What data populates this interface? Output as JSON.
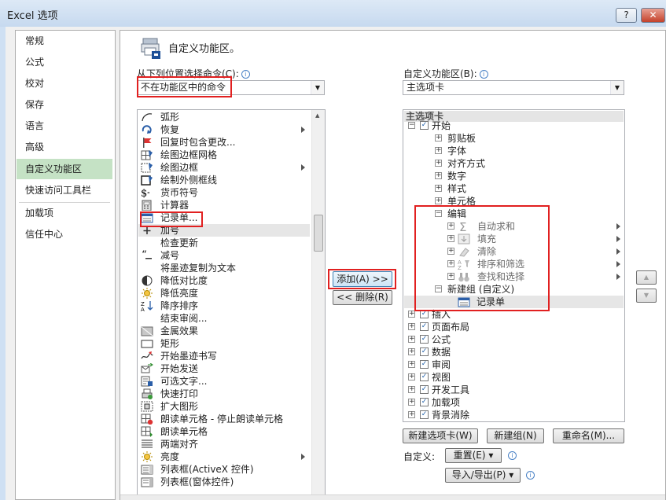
{
  "window": {
    "title": "Excel 选项",
    "help_label": "?",
    "close_label": "✕"
  },
  "nav": {
    "items": [
      {
        "label": "常规"
      },
      {
        "label": "公式"
      },
      {
        "label": "校对"
      },
      {
        "label": "保存"
      },
      {
        "label": "语言"
      },
      {
        "label": "高级"
      },
      {
        "label": "自定义功能区"
      },
      {
        "label": "快速访问工具栏"
      },
      {
        "label": "加载项"
      },
      {
        "label": "信任中心"
      }
    ],
    "selected": "自定义功能区"
  },
  "header": {
    "title": "自定义功能区。"
  },
  "left": {
    "label": "从下列位置选择命令(C):",
    "combo_value": "不在功能区中的命令",
    "commands": [
      {
        "label": "弧形",
        "icon": "arc-icon"
      },
      {
        "label": "恢复",
        "icon": "redo-icon",
        "submenu": true
      },
      {
        "label": "回复时包含更改...",
        "icon": "flag-icon"
      },
      {
        "label": "绘图边框网格",
        "icon": "border-grid-icon"
      },
      {
        "label": "绘图边框",
        "icon": "draw-border-icon",
        "submenu": true
      },
      {
        "label": "绘制外侧框线",
        "icon": "outside-border-icon"
      },
      {
        "label": "货币符号",
        "icon": "currency-icon"
      },
      {
        "label": "计算器",
        "icon": "calculator-icon"
      },
      {
        "label": "记录单...",
        "icon": "form-icon"
      },
      {
        "label": "加号",
        "icon": "plus-icon"
      },
      {
        "label": "检查更新",
        "icon": "none"
      },
      {
        "label": "减号",
        "icon": "minus-quote-icon"
      },
      {
        "label": "将墨迹复制为文本",
        "icon": "none"
      },
      {
        "label": "降低对比度",
        "icon": "contrast-icon"
      },
      {
        "label": "降低亮度",
        "icon": "brightness-icon"
      },
      {
        "label": "降序排序",
        "icon": "sort-desc-icon"
      },
      {
        "label": "结束审阅...",
        "icon": "none"
      },
      {
        "label": "金属效果",
        "icon": "metal-icon"
      },
      {
        "label": "矩形",
        "icon": "rectangle-icon"
      },
      {
        "label": "开始墨迹书写",
        "icon": "ink-icon"
      },
      {
        "label": "开始发送",
        "icon": "send-icon"
      },
      {
        "label": "可选文字...",
        "icon": "alt-text-icon"
      },
      {
        "label": "快速打印",
        "icon": "quick-print-icon"
      },
      {
        "label": "扩大图形",
        "icon": "enlarge-icon"
      },
      {
        "label": "朗读单元格 - 停止朗读单元格",
        "icon": "speak-stop-icon"
      },
      {
        "label": "朗读单元格",
        "icon": "speak-icon"
      },
      {
        "label": "两端对齐",
        "icon": "justify-icon"
      },
      {
        "label": "亮度",
        "icon": "sun-icon",
        "submenu": true
      },
      {
        "label": "列表框(ActiveX 控件)",
        "icon": "listbox-icon"
      },
      {
        "label": "列表框(窗体控件)",
        "icon": "listbox-form-icon"
      }
    ]
  },
  "middle": {
    "add_label": "添加(A) >>",
    "remove_label": "<< 删除(R)"
  },
  "right": {
    "label": "自定义功能区(B):",
    "combo_value": "主选项卡",
    "tree_header": "主选项卡",
    "tree": [
      {
        "label": "开始",
        "level": 0,
        "exp": "⊟",
        "chk": true
      },
      {
        "label": "剪贴板",
        "level": 1,
        "exp": "⊞"
      },
      {
        "label": "字体",
        "level": 1,
        "exp": "⊞"
      },
      {
        "label": "对齐方式",
        "level": 1,
        "exp": "⊞"
      },
      {
        "label": "数字",
        "level": 1,
        "exp": "⊞"
      },
      {
        "label": "样式",
        "level": 1,
        "exp": "⊞"
      },
      {
        "label": "单元格",
        "level": 1,
        "exp": "⊞"
      },
      {
        "label": "编辑",
        "level": 1,
        "exp": "⊟"
      },
      {
        "label": "自动求和",
        "level": 2,
        "exp": "⊞",
        "icon": "sigma-icon",
        "submenu": true,
        "grey": true
      },
      {
        "label": "填充",
        "level": 2,
        "exp": "⊞",
        "icon": "fill-down-icon",
        "submenu": true,
        "grey": true
      },
      {
        "label": "清除",
        "level": 2,
        "exp": "⊞",
        "icon": "eraser-icon",
        "submenu": true,
        "grey": true
      },
      {
        "label": "排序和筛选",
        "level": 2,
        "exp": "⊞",
        "icon": "sort-filter-icon",
        "submenu": true,
        "grey": true
      },
      {
        "label": "查找和选择",
        "level": 2,
        "exp": "⊞",
        "icon": "binoculars-icon",
        "submenu": true,
        "grey": true
      },
      {
        "label": "新建组 (自定义)",
        "level": 1,
        "exp": "⊟"
      },
      {
        "label": "记录单",
        "level": 2,
        "icon": "form-icon",
        "selected": true
      },
      {
        "label": "插入",
        "level": 0,
        "exp": "⊞",
        "chk": true
      },
      {
        "label": "页面布局",
        "level": 0,
        "exp": "⊞",
        "chk": true
      },
      {
        "label": "公式",
        "level": 0,
        "exp": "⊞",
        "chk": true
      },
      {
        "label": "数据",
        "level": 0,
        "exp": "⊞",
        "chk": true
      },
      {
        "label": "审阅",
        "level": 0,
        "exp": "⊞",
        "chk": true
      },
      {
        "label": "视图",
        "level": 0,
        "exp": "⊞",
        "chk": true
      },
      {
        "label": "开发工具",
        "level": 0,
        "exp": "⊞",
        "chk": true
      },
      {
        "label": "加载项",
        "level": 0,
        "exp": "⊞",
        "chk": true
      },
      {
        "label": "背景消除",
        "level": 0,
        "exp": "⊞",
        "chk": true
      }
    ],
    "new_tab_label": "新建选项卡(W)",
    "new_group_label": "新建组(N)",
    "rename_label": "重命名(M)...",
    "custom_label": "自定义:",
    "reset_label": "重置(E) ▾",
    "import_export_label": "导入/导出(P) ▾"
  },
  "arrows": {
    "up": "▲",
    "down": "▼"
  }
}
